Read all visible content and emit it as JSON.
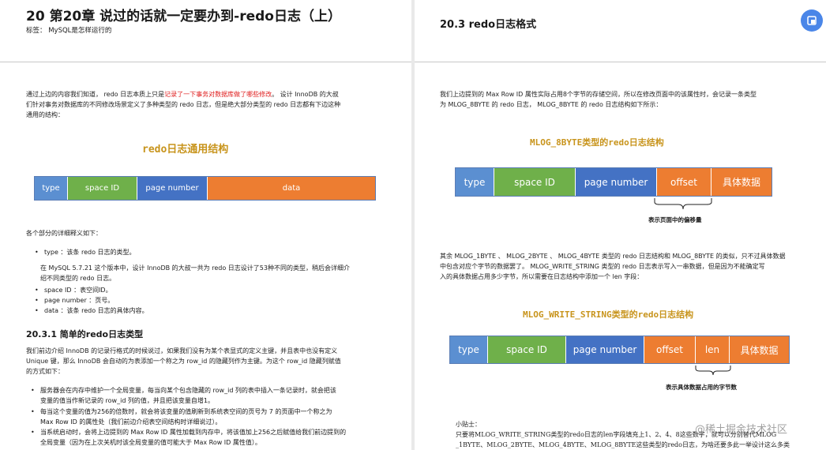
{
  "left": {
    "chapter_title": "20  第20章 说过的话就一定要办到-redo日志（上）",
    "tags": "标签：  MySQL是怎样运行的",
    "intro_a": "通过上边的内容我们知道， redo 日志本质上只是",
    "intro_red": "记录了一下事务对数据库做了哪些修改",
    "intro_b": "。 设计 InnoDB 的大叔",
    "intro_line2": "们针对事务对数据库的不同修改场景定义了多种类型的 redo 日志，但是绝大部分类型的 redo 日志都有下边这种",
    "intro_line3": "通用的结构：",
    "diagram_title": "redo日志通用结构",
    "diagram_fields": [
      "type",
      "space ID",
      "page number",
      "data"
    ],
    "detail_intro": "各个部分的详细释义如下：",
    "bullet_type": "type ：该条 redo 日志的类型。",
    "type_note_1": "在 MySQL 5.7.21 这个版本中，设计 InnoDB 的大叔一共为 redo 日志设计了53种不同的类型，稍后会详细介",
    "type_note_2": "绍不同类型的 redo 日志。",
    "bullet_space": "space ID ：表空间ID。",
    "bullet_page": "page number ：页号。",
    "bullet_data": "data ：该条 redo 日志的具体内容。",
    "section_title": "20.3.1  简单的redo日志类型",
    "s_p1": "我们前边介绍 InnoDB 的记录行格式的时候说过，如果我们没有为某个表显式的定义主键，并且表中也没有定义",
    "s_p2": "Unique 键，那么 InnoDB 会自动的为表添加一个称之为 row_id 的隐藏列作为主键。为这个 row_id 隐藏列赋值",
    "s_p3": "的方式如下：",
    "b1_1": "服务器会在内存中维护一个全局变量，每当向某个包含隐藏的 row_id 列的表中插入一条记录时，就会把该",
    "b1_2": "变量的值当作新记录的 row_id 列的值，并且把该变量自增1。",
    "b2_1": "每当这个变量的值为256的倍数时，就会将该变量的值刷新到系统表空间的页号为 7 的页面中一个称之为",
    "b2_2": "Max Row ID 的属性处（我们前边介绍表空间结构时详细说过）。",
    "b3_1": "当系统启动时，会将上边提到的 Max Row ID 属性加载到内存中，将该值加上256之后赋值给我们前边提到的",
    "b3_2": "全局变量（因为在上次关机时该全局变量的值可能大于 Max Row ID 属性值）。"
  },
  "right": {
    "section_title": "20.3  redo日志格式",
    "p1_1": "我们上边提到的 Max Row ID 属性实际占用8个字节的存储空间，所以在修改页面中的该属性时，会记录一条类型",
    "p1_2": "为 MLOG_8BYTE 的 redo 日志， MLOG_8BYTE 的 redo 日志结构如下所示：",
    "diagram1_title": "MLOG_8BYTE类型的redo日志结构",
    "diagram1_fields": [
      "type",
      "space ID",
      "page number",
      "offset",
      "具体数据"
    ],
    "diagram1_note": "表示页面中的偏移量",
    "p2_1": "其余 MLOG_1BYTE 、 MLOG_2BYTE 、 MLOG_4BYTE 类型的 redo 日志结构和 MLOG_8BYTE 的类似，只不过具体数据",
    "p2_2": "中包含对应个字节的数据罢了。 MLOG_WRITE_STRING 类型的 redo 日志表示写入一串数据，但是因为不能确定写",
    "p2_3": "入的具体数据占用多少字节，所以需要在日志结构中添加一个 len 字段：",
    "diagram2_title": "MLOG_WRITE_STRING类型的redo日志结构",
    "diagram2_fields": [
      "type",
      "space ID",
      "page number",
      "offset",
      "len",
      "具体数据"
    ],
    "diagram2_note": "表示具体数据占用的字节数",
    "tip_label": "小贴士：",
    "tip_1": "只要将MLOG_WRITE_STRING类型的redo日志的len字段填充上1、2、4、8这些数字，就可以分别替代MLOG",
    "tip_2": "_1BYTE、MLOG_2BYTE、MLOG_4BYTE、MLOG_8BYTE这些类型的redo日志，为啥还要多此一举设计这么多类"
  },
  "watermark": "@稀土掘金技术社区",
  "colors": {
    "blue": "#5b8fd1",
    "green": "#6fb04a",
    "navy": "#4472c4",
    "orange": "#ed7d31",
    "gold": "#c8941c",
    "red": "#e02020"
  }
}
